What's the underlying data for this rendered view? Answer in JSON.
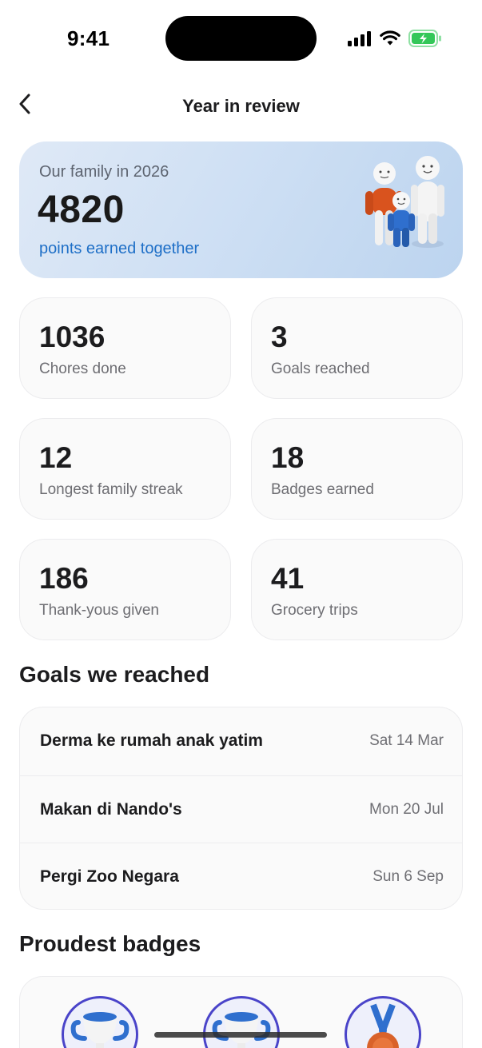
{
  "status_bar": {
    "time": "9:41",
    "icons": [
      "cellular-signal-icon",
      "wifi-icon",
      "battery-charging-icon"
    ],
    "battery_color": "#34c759"
  },
  "nav": {
    "title": "Year in review",
    "back_icon": "chevron-left-icon"
  },
  "hero": {
    "kicker": "Our family in 2026",
    "points": "4820",
    "subtitle": "points earned together",
    "illustration": "family-figures-illustration",
    "accent_color": "#1e6fc7"
  },
  "stats": [
    {
      "value": "1036",
      "label": "Chores done"
    },
    {
      "value": "3",
      "label": "Goals reached"
    },
    {
      "value": "12",
      "label": "Longest family streak"
    },
    {
      "value": "18",
      "label": "Badges earned"
    },
    {
      "value": "186",
      "label": "Thank-yous given"
    },
    {
      "value": "41",
      "label": "Grocery trips"
    }
  ],
  "goals_section": {
    "heading": "Goals we reached",
    "items": [
      {
        "name": "Derma ke rumah anak yatim",
        "date": "Sat 14 Mar"
      },
      {
        "name": "Makan di Nando's",
        "date": "Mon 20 Jul"
      },
      {
        "name": "Pergi Zoo Negara",
        "date": "Sun 6 Sep"
      }
    ]
  },
  "badges_section": {
    "heading": "Proudest badges",
    "badges": [
      {
        "icon": "trophy-icon"
      },
      {
        "icon": "trophy-icon"
      },
      {
        "icon": "medal-icon"
      }
    ],
    "ring_color": "#4a44c9"
  }
}
